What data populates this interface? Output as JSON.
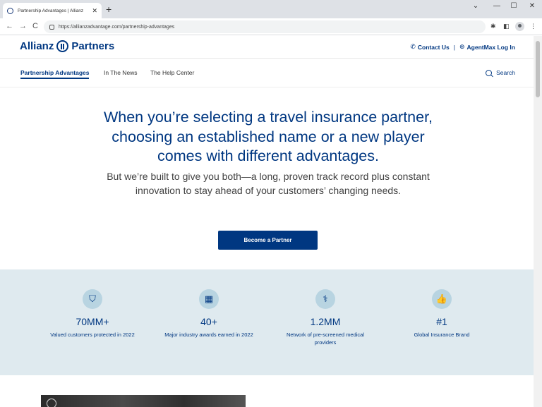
{
  "browser": {
    "tab_title": "Partnership Advantages | Allianz",
    "tab_close": "✕",
    "new_tab": "+",
    "url": "https://allianzadvantage.com/partnership-advantages",
    "back": "←",
    "forward": "→",
    "reload": "C",
    "win_min": "⌄",
    "win_minimize": "—",
    "win_max": "☐",
    "win_close": "✕",
    "ext_icon": "✱",
    "side_panel": "◧",
    "menu": "⋮"
  },
  "header": {
    "brand_left": "Allianz",
    "brand_right": "Partners",
    "contact_label": "Contact Us",
    "contact_icon": "✆",
    "separator": "|",
    "agentmax_icon": "⊕",
    "agentmax_label": "AgentMax Log In"
  },
  "nav": {
    "items": [
      {
        "label": "Partnership Advantages"
      },
      {
        "label": "In The News"
      },
      {
        "label": "The Help Center"
      }
    ],
    "search_label": "Search"
  },
  "hero": {
    "title": "When you’re selecting a travel insurance partner, choosing an established name or a new player comes with different advantages.",
    "subtitle": "But we’re built to give you both—a long, proven track record plus constant innovation to stay ahead of your customers’ changing needs.",
    "cta_label": "Become a Partner"
  },
  "stats": [
    {
      "icon": "shield-icon",
      "glyph": "⛉",
      "value": "70MM+",
      "label": "Valued customers protected in 2022"
    },
    {
      "icon": "calendar-icon",
      "glyph": "▦",
      "value": "40+",
      "label": "Major industry awards earned in 2022"
    },
    {
      "icon": "stethoscope-icon",
      "glyph": "⚕",
      "value": "1.2MM",
      "label": "Network of pre-screened medical providers"
    },
    {
      "icon": "thumbs-up-icon",
      "glyph": "👍",
      "value": "#1",
      "label": "Global Insurance Brand"
    }
  ],
  "colors": {
    "brand": "#003781",
    "stats_bg": "#dfeaef"
  }
}
